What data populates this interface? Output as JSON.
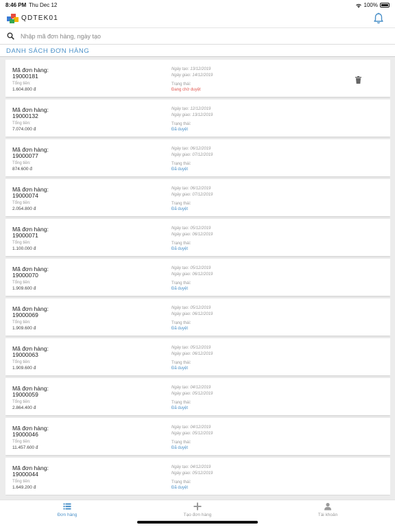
{
  "status_bar": {
    "time": "8:46 PM",
    "date": "Thu Dec 12",
    "battery": "100%"
  },
  "header": {
    "brand": "QDTEK01"
  },
  "search": {
    "placeholder": "Nhập mã đơn hàng, ngày tạo"
  },
  "section_title": "DANH SÁCH ĐƠN HÀNG",
  "labels": {
    "order_code": "Mã đơn hàng:",
    "total": "Tổng tiền:",
    "status": "Trạng thái:"
  },
  "colors": {
    "accent": "#4a90c8",
    "pending": "#e0574f",
    "approved": "#4a90c8"
  },
  "orders": [
    {
      "code": "19000181",
      "total": "1.604.800 đ",
      "created": "Ngày tạo: 13/12/2019",
      "delivery": "Ngày giao: 14/12/2019",
      "status": "Đang chờ duyệt",
      "status_type": "pending",
      "deletable": true
    },
    {
      "code": "19000132",
      "total": "7.074.000 đ",
      "created": "Ngày tạo: 12/12/2019",
      "delivery": "Ngày giao: 13/12/2019",
      "status": "Đã duyệt",
      "status_type": "approved",
      "deletable": false
    },
    {
      "code": "19000077",
      "total": "874.600 đ",
      "created": "Ngày tạo: 06/12/2019",
      "delivery": "Ngày giao: 07/12/2019",
      "status": "Đã duyệt",
      "status_type": "approved",
      "deletable": false
    },
    {
      "code": "19000074",
      "total": "2.054.800 đ",
      "created": "Ngày tạo: 06/12/2019",
      "delivery": "Ngày giao: 07/12/2019",
      "status": "Đã duyệt",
      "status_type": "approved",
      "deletable": false
    },
    {
      "code": "19000071",
      "total": "1.100.000 đ",
      "created": "Ngày tạo: 05/12/2019",
      "delivery": "Ngày giao: 06/12/2019",
      "status": "Đã duyệt",
      "status_type": "approved",
      "deletable": false
    },
    {
      "code": "19000070",
      "total": "1.909.600 đ",
      "created": "Ngày tạo: 05/12/2019",
      "delivery": "Ngày giao: 06/12/2019",
      "status": "Đã duyệt",
      "status_type": "approved",
      "deletable": false
    },
    {
      "code": "19000069",
      "total": "1.909.600 đ",
      "created": "Ngày tạo: 05/12/2019",
      "delivery": "Ngày giao: 06/12/2019",
      "status": "Đã duyệt",
      "status_type": "approved",
      "deletable": false
    },
    {
      "code": "19000063",
      "total": "1.909.600 đ",
      "created": "Ngày tạo: 05/12/2019",
      "delivery": "Ngày giao: 06/12/2019",
      "status": "Đã duyệt",
      "status_type": "approved",
      "deletable": false
    },
    {
      "code": "19000059",
      "total": "2.864.400 đ",
      "created": "Ngày tạo: 04/12/2019",
      "delivery": "Ngày giao: 05/12/2019",
      "status": "Đã duyệt",
      "status_type": "approved",
      "deletable": false
    },
    {
      "code": "19000046",
      "total": "11.457.600 đ",
      "created": "Ngày tạo: 04/12/2019",
      "delivery": "Ngày giao: 05/12/2019",
      "status": "Đã duyệt",
      "status_type": "approved",
      "deletable": false
    },
    {
      "code": "19000044",
      "total": "1.649.200 đ",
      "created": "Ngày tạo: 04/12/2019",
      "delivery": "Ngày giao: 05/12/2019",
      "status": "Đã duyệt",
      "status_type": "approved",
      "deletable": false
    }
  ],
  "tabs": [
    {
      "label": "Đơn hàng",
      "icon": "list-icon",
      "active": true
    },
    {
      "label": "Tạo đơn hàng",
      "icon": "plus-icon",
      "active": false
    },
    {
      "label": "Tài khoản",
      "icon": "user-icon",
      "active": false
    }
  ]
}
